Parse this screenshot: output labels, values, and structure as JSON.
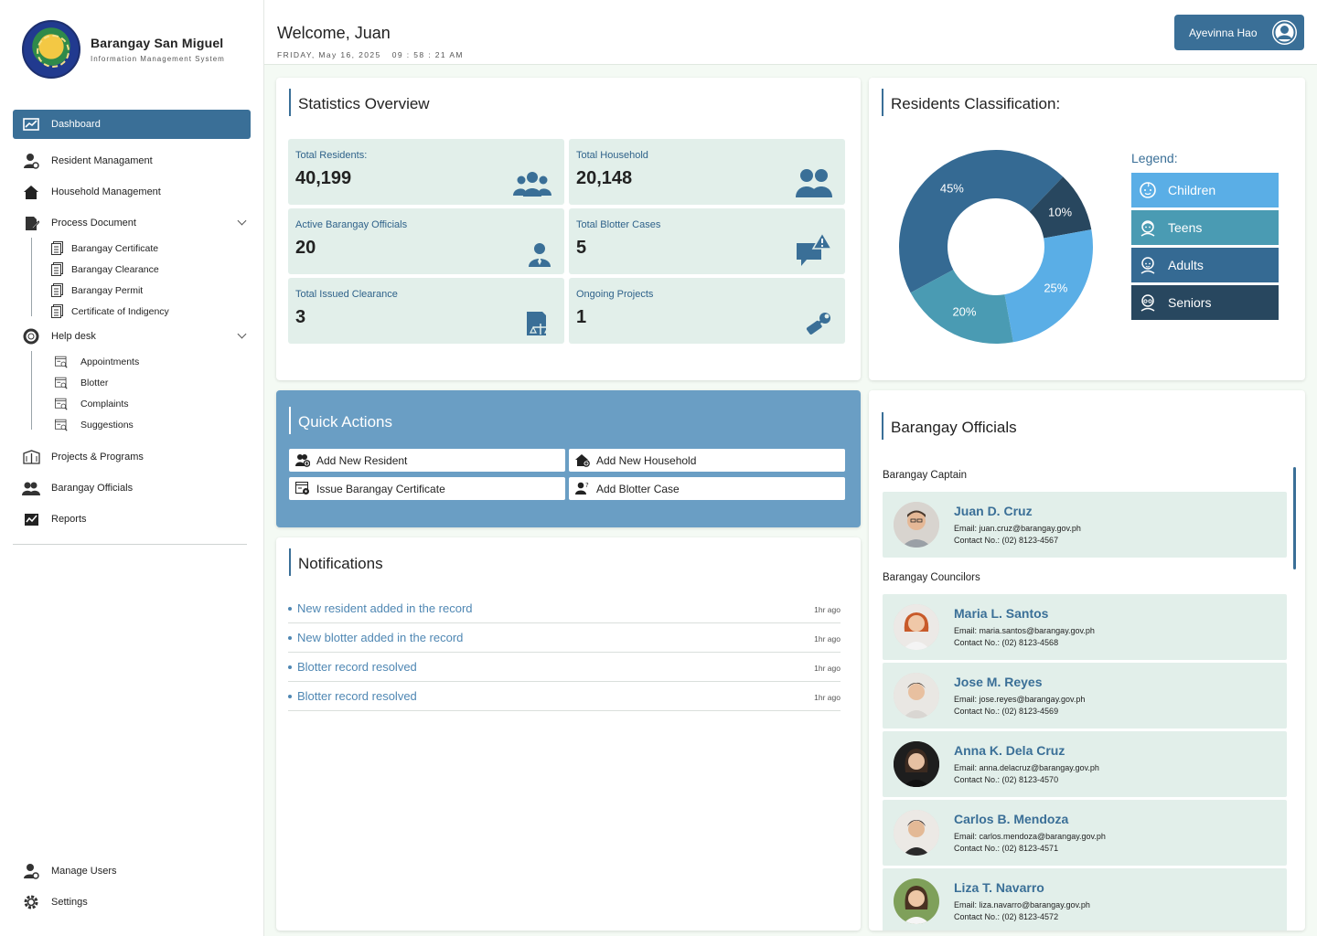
{
  "brand": {
    "title": "Barangay San Miguel",
    "subtitle": "Information Management System"
  },
  "header": {
    "welcome": "Welcome, Juan",
    "date": "FRIDAY, May 16, 2025",
    "time": "09 : 58 : 21 AM",
    "user": "Ayevinna Hao"
  },
  "sidebar": {
    "items": [
      {
        "label": "Dashboard",
        "icon": "chart-icon"
      },
      {
        "label": "Resident Managament",
        "icon": "resident-icon"
      },
      {
        "label": "Household Management",
        "icon": "house-icon"
      },
      {
        "label": "Process Document",
        "icon": "document-edit-icon"
      },
      {
        "label": "Help desk",
        "icon": "helpdesk-icon"
      },
      {
        "label": "Projects & Programs",
        "icon": "projects-icon"
      },
      {
        "label": "Barangay Officials",
        "icon": "officials-icon"
      },
      {
        "label": "Reports",
        "icon": "reports-icon"
      }
    ],
    "process_sub": [
      "Barangay Certificate",
      "Barangay Clearance",
      "Barangay Permit",
      "Certificate of Indigency"
    ],
    "helpdesk_sub": [
      "Appointments",
      "Blotter",
      "Complaints",
      "Suggestions"
    ],
    "bottom": [
      "Manage Users",
      "Settings"
    ]
  },
  "stats": {
    "title": "Statistics Overview",
    "boxes": [
      {
        "label": "Total Residents:",
        "value": "40,199",
        "icon": "group-icon"
      },
      {
        "label": "Total Household",
        "value": "20,148",
        "icon": "household-people-icon"
      },
      {
        "label": "Active Barangay Officials",
        "value": "20",
        "icon": "official-person-icon"
      },
      {
        "label": "Total Blotter Cases",
        "value": "5",
        "icon": "alert-chat-icon"
      },
      {
        "label": "Total Issued Clearance",
        "value": "3",
        "icon": "clearance-scale-icon"
      },
      {
        "label": "Ongoing Projects",
        "value": "1",
        "icon": "tools-icon"
      }
    ]
  },
  "classification": {
    "title": "Residents Classification:",
    "legend_title": "Legend:",
    "legend": [
      {
        "label": "Children",
        "color": "#5aaee6"
      },
      {
        "label": "Teens",
        "color": "#4a9bb3"
      },
      {
        "label": "Adults",
        "color": "#356a93"
      },
      {
        "label": "Seniors",
        "color": "#28475f"
      }
    ]
  },
  "chart_data": {
    "type": "pie",
    "labels": [
      "Adults",
      "Seniors",
      "Children",
      "Teens"
    ],
    "values": [
      45,
      10,
      25,
      20
    ],
    "value_labels": [
      "45%",
      "10%",
      "25%",
      "20%"
    ],
    "colors": [
      "#356a93",
      "#28475f",
      "#5aaee6",
      "#4a9bb3"
    ],
    "donut": true
  },
  "quick": {
    "title": "Quick Actions",
    "actions": [
      "Add New Resident",
      "Add New Household",
      "Issue Barangay Certificate",
      "Add Blotter Case"
    ]
  },
  "notifications": {
    "title": "Notifications",
    "items": [
      {
        "text": "New resident added in the record",
        "ago": "1hr ago"
      },
      {
        "text": "New blotter added in the record",
        "ago": "1hr ago"
      },
      {
        "text": "Blotter record resolved",
        "ago": "1hr ago"
      },
      {
        "text": "Blotter record resolved",
        "ago": "1hr ago"
      }
    ]
  },
  "officials": {
    "title": "Barangay Officials",
    "captain_label": "Barangay Captain",
    "councilors_label": "Barangay Councilors",
    "captain": {
      "name": "Juan D. Cruz",
      "email": "Email: juan.cruz@barangay.gov.ph",
      "contact": "Contact No.: (02) 8123-4567"
    },
    "councilors": [
      {
        "name": "Maria L. Santos",
        "email": "Email: maria.santos@barangay.gov.ph",
        "contact": "Contact No.: (02) 8123-4568"
      },
      {
        "name": "Jose M. Reyes",
        "email": "Email: jose.reyes@barangay.gov.ph",
        "contact": "Contact No.: (02) 8123-4569"
      },
      {
        "name": "Anna K. Dela Cruz",
        "email": "Email: anna.delacruz@barangay.gov.ph",
        "contact": "Contact No.: (02) 8123-4570"
      },
      {
        "name": "Carlos B. Mendoza",
        "email": "Email: carlos.mendoza@barangay.gov.ph",
        "contact": "Contact No.: (02) 8123-4571"
      },
      {
        "name": "Liza T. Navarro",
        "email": "Email: liza.navarro@barangay.gov.ph",
        "contact": "Contact No.: (02) 8123-4572"
      }
    ]
  },
  "colors": {
    "primary": "#3a6f97",
    "quick_bg": "#6a9ec4",
    "stat_bg": "#e2efea",
    "notif_text": "#4f87b3"
  }
}
